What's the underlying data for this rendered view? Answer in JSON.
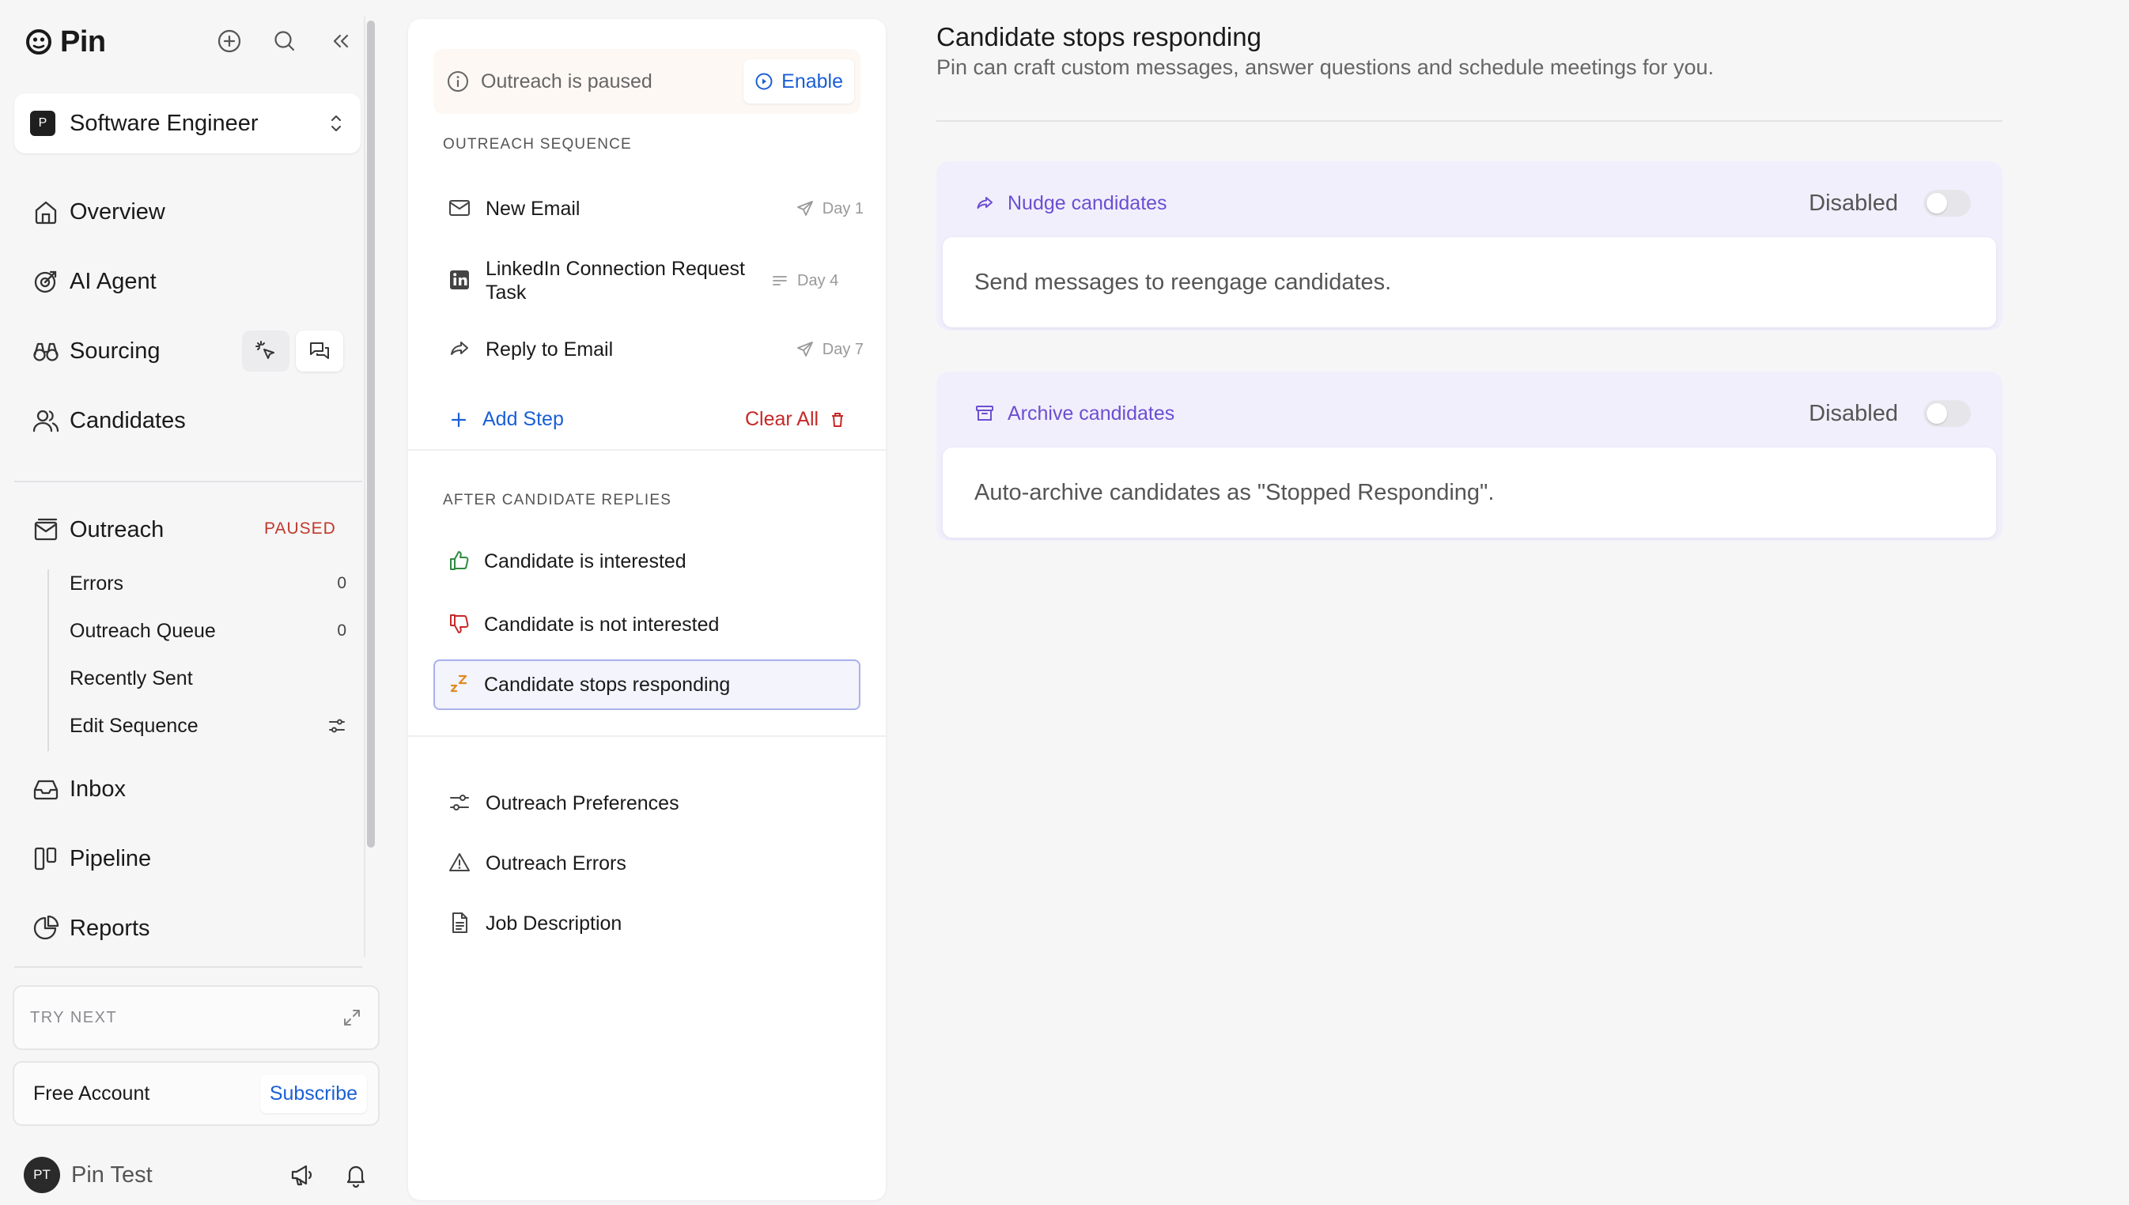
{
  "app": {
    "name": "Pin"
  },
  "role": {
    "badge": "P",
    "name": "Software Engineer"
  },
  "nav": {
    "overview": "Overview",
    "ai_agent": "AI Agent",
    "sourcing": "Sourcing",
    "candidates": "Candidates",
    "outreach": "Outreach",
    "outreach_badge": "PAUSED",
    "inbox": "Inbox",
    "pipeline": "Pipeline",
    "reports": "Reports"
  },
  "outreach_sub": [
    {
      "label": "Errors",
      "count": "0"
    },
    {
      "label": "Outreach Queue",
      "count": "0"
    },
    {
      "label": "Recently Sent"
    },
    {
      "label": "Edit Sequence"
    }
  ],
  "try_next": {
    "label": "TRY NEXT"
  },
  "account": {
    "label": "Free Account",
    "subscribe": "Subscribe"
  },
  "user": {
    "initials": "PT",
    "name": "Pin Test"
  },
  "panel": {
    "paused_text": "Outreach is paused",
    "enable_label": "Enable",
    "sequence_title": "OUTREACH SEQUENCE",
    "steps": [
      {
        "label": "New Email",
        "day": "Day 1",
        "icon": "mail-icon"
      },
      {
        "label": "LinkedIn Connection Request Task",
        "day": "Day 4",
        "icon": "linkedin-icon"
      },
      {
        "label": "Reply to Email",
        "day": "Day 7",
        "icon": "reply-icon"
      }
    ],
    "add_step": "Add Step",
    "clear_all": "Clear All",
    "replies_title": "AFTER CANDIDATE REPLIES",
    "replies": [
      {
        "label": "Candidate is interested",
        "color": "#2e8b3e"
      },
      {
        "label": "Candidate is not interested",
        "color": "#c62828"
      },
      {
        "label": "Candidate stops responding",
        "color": "#e08a1e"
      }
    ],
    "links": [
      {
        "label": "Outreach Preferences"
      },
      {
        "label": "Outreach Errors"
      },
      {
        "label": "Job Description"
      }
    ]
  },
  "content": {
    "title": "Candidate stops responding",
    "subtitle": "Pin can craft custom messages, answer questions and schedule meetings for you.",
    "cards": [
      {
        "title": "Nudge candidates",
        "status": "Disabled",
        "description": "Send messages to reengage candidates.",
        "enabled": false
      },
      {
        "title": "Archive candidates",
        "status": "Disabled",
        "description": "Auto-archive candidates as \"Stopped Responding\".",
        "enabled": false
      }
    ]
  },
  "colors": {
    "accent": "#1a5fd6",
    "purple": "#6b4fd2",
    "danger": "#c62828"
  }
}
